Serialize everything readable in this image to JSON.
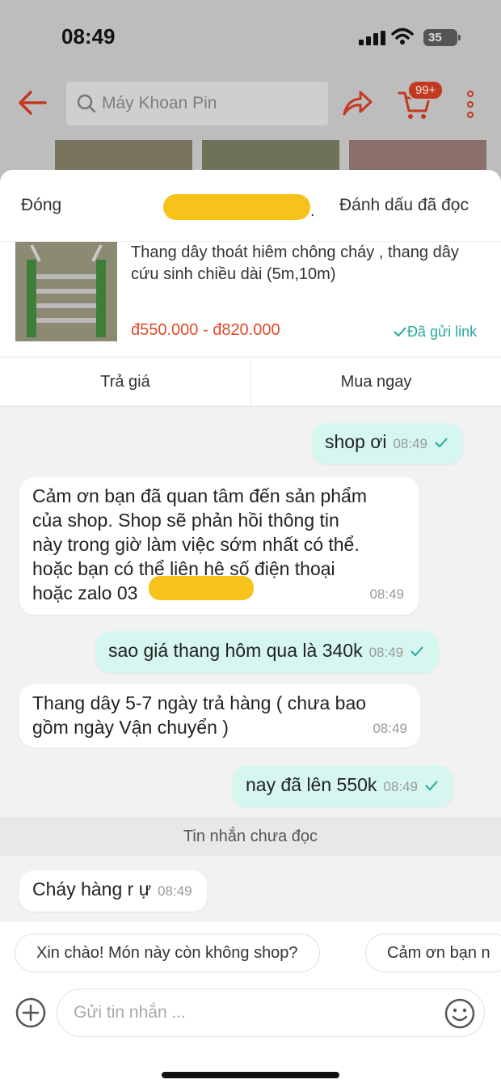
{
  "status_bar": {
    "time": "08:49",
    "battery": "35"
  },
  "nav": {
    "search_placeholder": "Máy Khoan Pin",
    "cart_badge": "99+"
  },
  "header": {
    "close_label": "Đóng",
    "separator": ".",
    "mark_read_label": "Đánh dấu đã đọc"
  },
  "product": {
    "title": "Thang dây thoát hiêm chông cháy , thang dây cứu sinh chiều dài (5m,10m)",
    "price": "đ550.000 - đ820.000",
    "sent_link": "Đã gửi link",
    "bargain_label": "Trả giá",
    "buy_now_label": "Mua ngay"
  },
  "messages": [
    {
      "direction": "out",
      "text": "shop ơi",
      "time": "08:49"
    },
    {
      "direction": "in",
      "lines": [
        "Cảm ơn bạn đã quan tâm đến sản phẩm",
        "của shop. Shop sẽ phản hồi thông tin",
        "này trong giờ làm việc sớm nhất có thể.",
        "hoặc bạn có thể liên hệ số điện thoại",
        "hoặc zalo 03"
      ],
      "time": "08:49"
    },
    {
      "direction": "out",
      "text": "sao giá thang hôm qua là 340k",
      "time": "08:49"
    },
    {
      "direction": "in",
      "lines": [
        "Thang dây 5-7 ngày trả hàng ( chưa bao",
        "gồm ngày Vận chuyển )"
      ],
      "time": "08:49"
    },
    {
      "direction": "out",
      "text": "nay đã lên 550k",
      "time": "08:49"
    },
    {
      "direction": "in",
      "text": "Cháy hàng r ự",
      "time": "08:49"
    }
  ],
  "unread_divider": "Tin nhắn chưa đọc",
  "suggestions": [
    "Xin chào! Món này còn không shop?",
    "Cảm ơn bạn n"
  ],
  "composer": {
    "placeholder": "Gửi tin nhắn ..."
  },
  "colors": {
    "brand": "#ee4d2d",
    "outgoing_bubble": "#d6f6f0",
    "check": "#26aa99",
    "price": "#e24a27"
  }
}
